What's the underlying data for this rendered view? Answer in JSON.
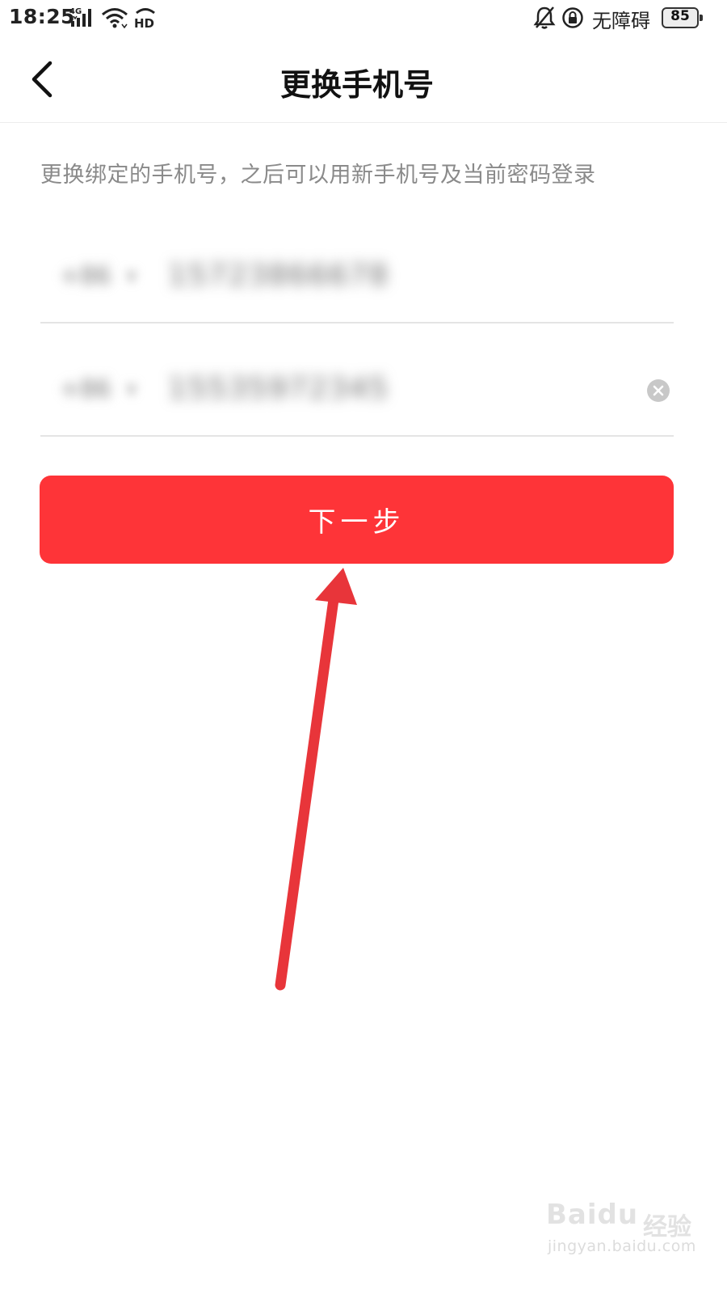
{
  "status_bar": {
    "time": "18:25",
    "network": "4G",
    "hd": "HD",
    "accessibility": "无障碍",
    "battery": "85",
    "icons": [
      "signal-4g-icon",
      "wifi-icon",
      "hd-call-icon",
      "bell-muted-icon",
      "lock-rotation-icon",
      "battery-icon"
    ]
  },
  "header": {
    "title": "更换手机号",
    "back_icon": "chevron-left-icon"
  },
  "description": "更换绑定的手机号，之后可以用新手机号及当前密码登录",
  "current_phone": {
    "country_code": "+86",
    "number": "15723866678"
  },
  "new_phone": {
    "country_code": "+86",
    "number": "15535972345",
    "clear_icon": "clear-circle-icon"
  },
  "next_button": "下一步",
  "colors": {
    "primary": "#fe3438",
    "annotation_arrow": "#e8353a",
    "description_text": "#8a8a8a"
  },
  "watermark": {
    "logo": "Baidu",
    "jingyan": "经验",
    "url": "jingyan.baidu.com"
  }
}
